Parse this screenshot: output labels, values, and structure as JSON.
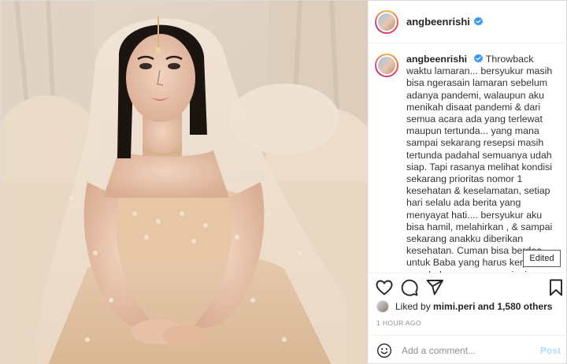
{
  "header": {
    "username": "angbeenrishi",
    "verified_icon": "verified-badge-icon"
  },
  "caption": {
    "username": "angbeenrishi",
    "text": "Throwback waktu lamaran... bersyukur masih bisa ngerasain lamaran sebelum adanya pandemi, walaupun aku menikah disaat pandemi & dari semua acara ada yang terlewat maupun tertunda... yang mana sampai sekarang resepsi masih tertunda padahal semuanya udah siap. Tapi rasanya melihat kondisi sekarang prioritas nomor 1 kesehatan & keselamatan, setiap hari selalu ada berita yang menyayat hati.... bersyukur aku bisa hamil, melahirkan , & sampai sekarang anakku diberikan kesehatan. Cuman bisa berdoa untuk Baba yang harus kerja diluar rumah, kangen rasanya ingin ketemu Baba... Semoga pandemi ini cepat berlalu",
    "trailing": "🤍"
  },
  "tooltip": {
    "label": "Edited"
  },
  "actions": {
    "icons": [
      "heart-icon",
      "comment-icon",
      "share-icon",
      "bookmark-icon"
    ]
  },
  "likes": {
    "prefix": "Liked by",
    "user": "mimi.peri",
    "suffix": "and 1,580 others"
  },
  "timestamp": "1 HOUR AGO",
  "comment": {
    "placeholder": "Add a comment...",
    "post_label": "Post"
  },
  "colors": {
    "verified": "#3897f0",
    "post_disabled": "#b3dbff",
    "muted": "#8e8e8e"
  }
}
